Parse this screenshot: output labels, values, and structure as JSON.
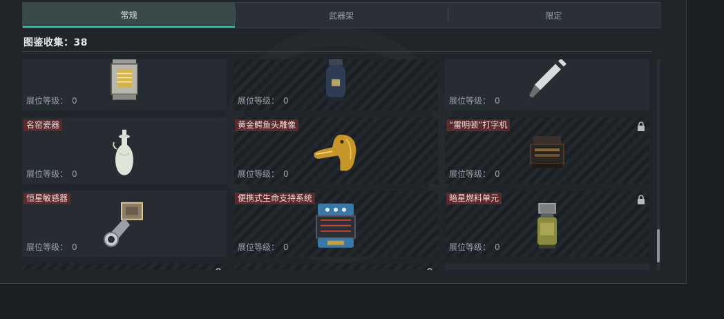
{
  "tabs": [
    {
      "label": "常规"
    },
    {
      "label": "武器架"
    },
    {
      "label": "限定"
    }
  ],
  "collection": {
    "label": "图鉴收集：",
    "count": "38"
  },
  "level_label": "展位等级：",
  "items": [
    {
      "name": "",
      "level": "0",
      "locked": false,
      "icon": "generator-icon"
    },
    {
      "name": "",
      "level": "0",
      "locked": false,
      "icon": "gas-canister-icon"
    },
    {
      "name": "",
      "level": "0",
      "locked": false,
      "icon": "pen-icon"
    },
    {
      "name": "名窑瓷器",
      "level": "0",
      "locked": false,
      "icon": "porcelain-vase-icon"
    },
    {
      "name": "黄金鳄鱼头雕像",
      "level": "0",
      "locked": false,
      "icon": "golden-crocodile-icon"
    },
    {
      "name": "“雷明顿”打字机",
      "level": "0",
      "locked": true,
      "icon": "typewriter-icon"
    },
    {
      "name": "恒星敏感器",
      "level": "0",
      "locked": false,
      "icon": "star-sensor-icon"
    },
    {
      "name": "便携式生命支持系统",
      "level": "0",
      "locked": false,
      "icon": "life-support-icon"
    },
    {
      "name": "暗星燃料单元",
      "level": "0",
      "locked": true,
      "icon": "fuel-cell-icon"
    },
    {
      "name": "",
      "level": "",
      "locked": true,
      "icon": ""
    },
    {
      "name": "",
      "level": "",
      "locked": true,
      "icon": ""
    },
    {
      "name": "",
      "level": "",
      "locked": true,
      "icon": ""
    }
  ],
  "colors": {
    "accent": "#2fd3a4",
    "name_badge": "#5a2a2c",
    "background": "#20252a"
  }
}
